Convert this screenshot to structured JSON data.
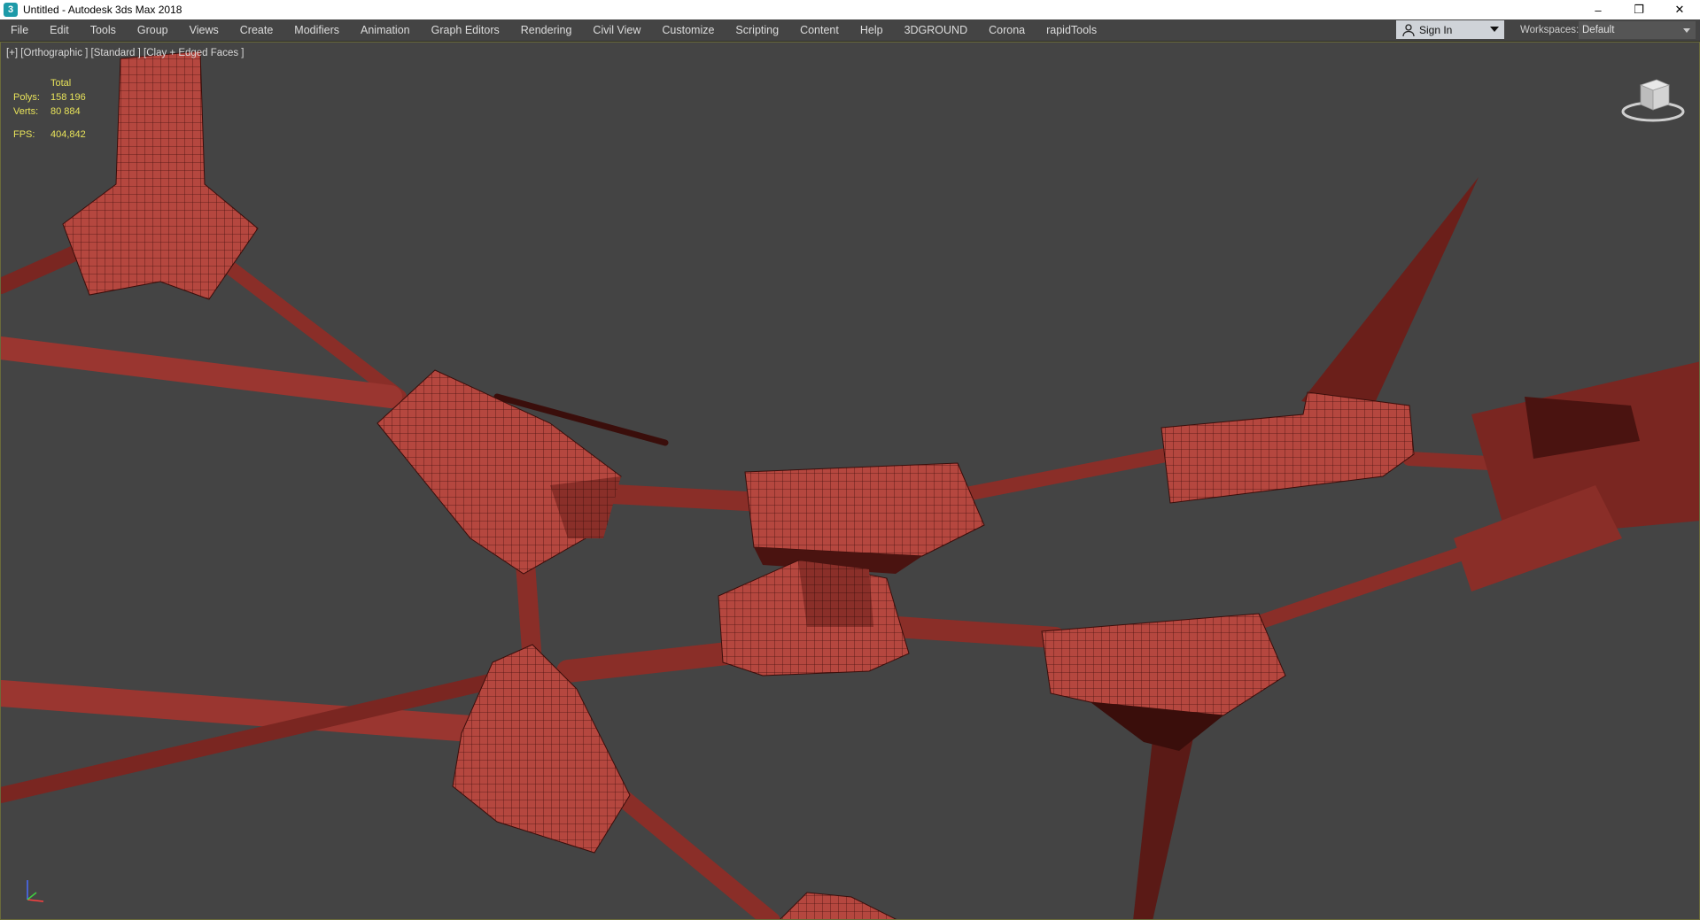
{
  "window": {
    "title": "Untitled - Autodesk 3ds Max 2018",
    "icon": "3ds-max-app-icon",
    "controls": [
      "minimize-icon",
      "restore-icon",
      "close-icon"
    ]
  },
  "menubar": {
    "items": [
      "File",
      "Edit",
      "Tools",
      "Group",
      "Views",
      "Create",
      "Modifiers",
      "Animation",
      "Graph Editors",
      "Rendering",
      "Civil View",
      "Customize",
      "Scripting",
      "Content",
      "Help",
      "3DGROUND",
      "Corona",
      "rapidTools"
    ],
    "sign_in": "Sign In",
    "workspaces_label": "Workspaces:",
    "workspace_value": "Default"
  },
  "viewport": {
    "label": "[+] [Orthographic ] [Standard ] [Clay + Edged Faces ]",
    "stats": {
      "header": "Total",
      "polys_label": "Polys:",
      "polys": "158 196",
      "verts_label": "Verts:",
      "verts": "80 884",
      "fps_label": "FPS:",
      "fps": "404,842"
    },
    "colors": {
      "background": "#444444",
      "mesh": "#b5473f",
      "mesh_dark": "#5a1a16",
      "stats_text": "#e8e35a"
    }
  }
}
